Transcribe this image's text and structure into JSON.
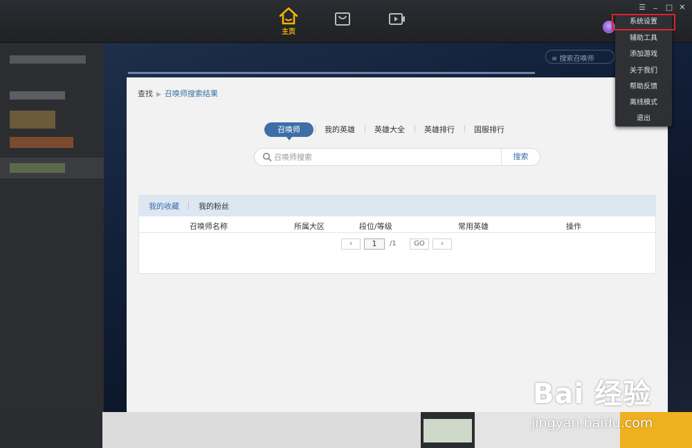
{
  "nav": {
    "home_label": "主页",
    "store_icon": "bag-icon",
    "video_icon": "video-icon"
  },
  "window": {
    "menu_glyph": "☰",
    "minimize_glyph": "_",
    "maximize_glyph": "□",
    "close_glyph": "✕"
  },
  "hero": {
    "search_placeholder": "搜索召唤师"
  },
  "breadcrumb": {
    "root": "查找",
    "sep": "▶",
    "current": "召唤师搜索结果"
  },
  "tabs": [
    "召唤师",
    "我的英雄",
    "英雄大全",
    "英雄排行",
    "国服排行"
  ],
  "search": {
    "placeholder": "召唤师搜索",
    "button": "搜索"
  },
  "card": {
    "tabs": [
      "我的收藏",
      "我的粉丝"
    ],
    "columns": [
      "召唤师名称",
      "所属大区",
      "段位/等级",
      "常用英雄",
      "操作"
    ],
    "pager": {
      "prev": "‹",
      "page": "1",
      "total": "/1",
      "go": "GO",
      "next": "›"
    }
  },
  "menu": {
    "items": [
      "系统设置",
      "辅助工具",
      "添加游戏",
      "关于我们",
      "帮助反馈",
      "离线模式",
      "退出"
    ],
    "highlighted_color": "#e0232b"
  },
  "watermark": {
    "brand": "Bai 经验",
    "url": "jingyan.baidu.com"
  },
  "colors": {
    "accent": "#3d6ea7",
    "home_active": "#f5b400"
  }
}
